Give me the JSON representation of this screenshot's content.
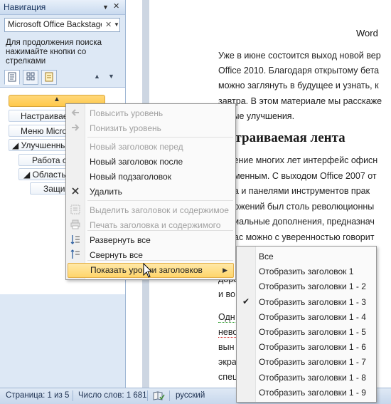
{
  "nav": {
    "title": "Навигация",
    "dropdown_glyph": "▼",
    "close_glyph": "✕",
    "search_value": "Microsoft Office Backstage",
    "search_clear": "✕",
    "hint": "Для продолжения поиска нажимайте кнопки со стрелками",
    "tab_icons": [
      "tab-headings-icon",
      "tab-pages-icon",
      "tab-results-icon"
    ],
    "prev_glyph": "▲",
    "next_glyph": "▼",
    "selected_glyph": "▲",
    "tree": [
      {
        "label": "Настраиваем",
        "indent": 0
      },
      {
        "label": "Меню Microsoft",
        "indent": 0
      },
      {
        "label": "◢ Улучшенные",
        "indent": 0
      },
      {
        "label": "Работа с д",
        "indent": 1
      },
      {
        "label": "◢ Область в",
        "indent": 1
      },
      {
        "label": "Защищ",
        "indent": 2
      }
    ]
  },
  "document": {
    "title": "Word",
    "para1": [
      "Уже в июне состоится выход новой вер",
      "Office 2010. Благодаря открытому бета",
      "можно заглянуть в будущее и узнать, к",
      "завтра. В этом материале мы расскаже",
      "овные улучшения."
    ],
    "heading": "страиваемая лента",
    "para2": [
      "чение многих лет интерфейс офисн",
      "аменным. С выходом Office 2007 от",
      "на и панелями инструментов прак",
      "ложений был столь революционны",
      "циальные дополнения, предназнач",
      "нас можно с уверенностью говорит",
      "о исключительно потому, что был"
    ],
    "para3": [
      "доро",
      "и во"
    ],
    "para4": [
      "Одн",
      "нево",
      "вын",
      "экра",
      "спец",
      "вын"
    ]
  },
  "context_menu": {
    "items": [
      {
        "label": "Повысить уровень",
        "icon": "promote-arrow-icon",
        "enabled": false
      },
      {
        "label": "Понизить уровень",
        "icon": "demote-arrow-icon",
        "enabled": false
      },
      {
        "label": "Новый заголовок перед",
        "icon": "",
        "enabled": false
      },
      {
        "label": "Новый заголовок после",
        "icon": "",
        "enabled": true
      },
      {
        "label": "Новый подзаголовок",
        "icon": "",
        "enabled": true
      },
      {
        "label": "Удалить",
        "icon": "delete-x-icon",
        "enabled": true
      },
      {
        "label": "Выделить заголовок и содержимое",
        "icon": "select-content-icon",
        "enabled": false
      },
      {
        "label": "Печать заголовка и содержимого",
        "icon": "print-icon",
        "enabled": false
      },
      {
        "label": "Развернуть все",
        "icon": "expand-all-icon",
        "enabled": true
      },
      {
        "label": "Свернуть все",
        "icon": "collapse-all-icon",
        "enabled": true
      },
      {
        "label": "Показать уровни заголовков",
        "icon": "",
        "enabled": true
      }
    ],
    "submenu_arrow": "▶"
  },
  "submenu": {
    "items": [
      {
        "label": "Все",
        "checked": false
      },
      {
        "label": "Отобразить заголовок 1",
        "checked": false
      },
      {
        "label": "Отобразить заголовки 1 - 2",
        "checked": false
      },
      {
        "label": "Отобразить заголовки 1 - 3",
        "checked": true
      },
      {
        "label": "Отобразить заголовки 1 - 4",
        "checked": false
      },
      {
        "label": "Отобразить заголовки 1 - 5",
        "checked": false
      },
      {
        "label": "Отобразить заголовки 1 - 6",
        "checked": false
      },
      {
        "label": "Отобразить заголовки 1 - 7",
        "checked": false
      },
      {
        "label": "Отобразить заголовки 1 - 8",
        "checked": false
      },
      {
        "label": "Отобразить заголовки 1 - 9",
        "checked": false
      }
    ],
    "check_glyph": "✔"
  },
  "status": {
    "page": "Страница: 1 из 5",
    "words": "Число слов: 1 681",
    "language": "русский",
    "proofing_icon": "proofing-book-icon"
  },
  "colors": {
    "accent": "#ffd56b",
    "pane_bg": "#dde8f5",
    "status_bg": "#c7d7ec"
  }
}
